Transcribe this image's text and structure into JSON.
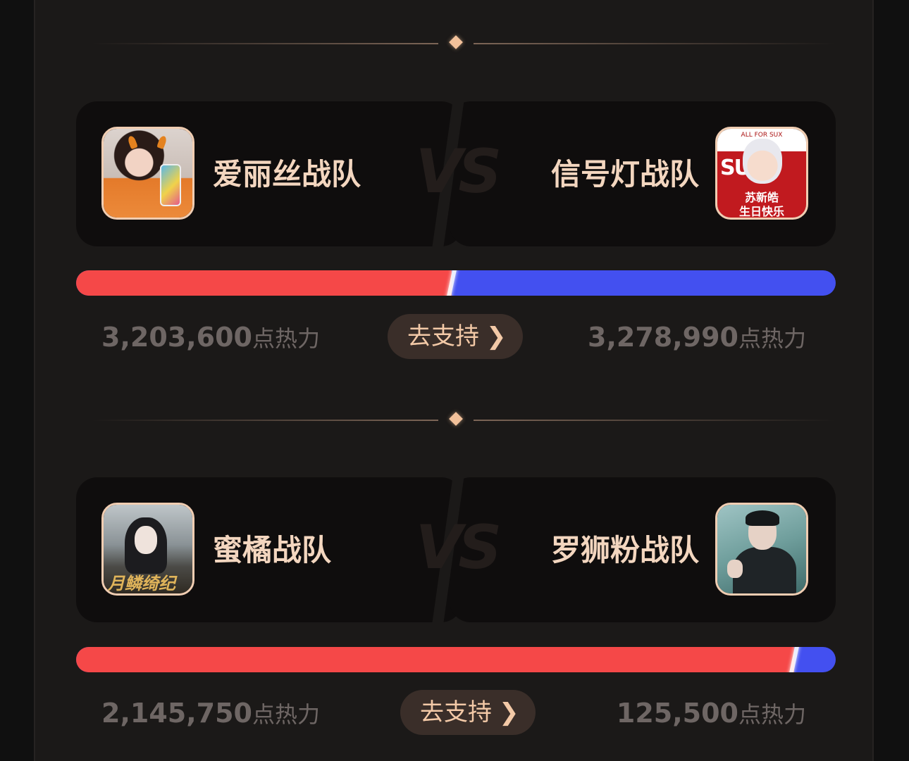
{
  "matchups": [
    {
      "left": {
        "name": "爱丽丝战队",
        "score": "3,203,600",
        "unit": "点热力"
      },
      "right": {
        "name": "信号灯战队",
        "score": "3,278,990",
        "unit": "点热力"
      },
      "vs_label": "VS",
      "support_label": "去支持",
      "red_share": 0.494,
      "right_avatar_text": {
        "top": "ALL FOR SUX",
        "big": "SUX",
        "caption_line1": "苏新皓",
        "caption_line2": "生日快乐"
      }
    },
    {
      "left": {
        "name": "蜜橘战队",
        "score": "2,145,750",
        "unit": "点热力"
      },
      "right": {
        "name": "罗狮粉战队",
        "score": "125,500",
        "unit": "点热力"
      },
      "vs_label": "VS",
      "support_label": "去支持",
      "red_share": 0.945,
      "left_avatar_text": {
        "title": "月鳞绮纪"
      }
    }
  ],
  "icons": {
    "support_chevron": "chevron-right-icon",
    "divider": "diamond-icon"
  },
  "colors": {
    "left_team": "#f54848",
    "right_team": "#4350f0",
    "accent": "#f3d6bf",
    "button_bg": "#3a2e29"
  }
}
